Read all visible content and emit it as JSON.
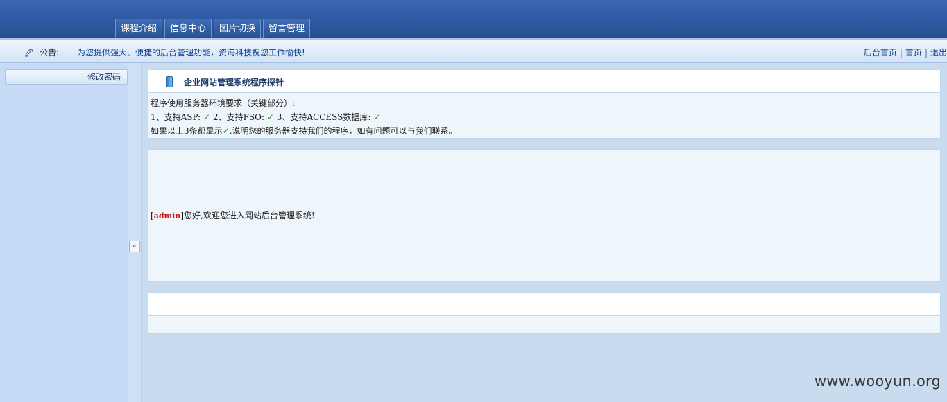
{
  "header": {
    "nav_tabs": [
      {
        "label": "课程介绍"
      },
      {
        "label": "信息中心"
      },
      {
        "label": "图片切换"
      },
      {
        "label": "留言管理"
      }
    ]
  },
  "notice": {
    "label": "公告:",
    "text": "为您提供强大、便捷的后台管理功能，资海科技祝您工作愉快!",
    "links": [
      {
        "label": "后台首页"
      },
      {
        "label": "首页"
      },
      {
        "label": "退出"
      }
    ],
    "separator": "|"
  },
  "sidebar": {
    "items": [
      {
        "label": "修改密码"
      }
    ],
    "collapse_label": "«"
  },
  "probe_panel": {
    "title": "企业网站管理系统程序探针",
    "line1": "程序使用服务器环境要求（关键部分）:",
    "req1": "1、支持ASP:",
    "req2": "2、支持FSO:",
    "req3": "3、支持ACCESS数据库:",
    "check_mark": "✓",
    "line3_pre": "如果以上3条都显示",
    "line3_post": ",说明您的服务器支持我们的程序，如有问题可以与我们联系。"
  },
  "welcome_panel": {
    "bracket_open": "[",
    "username": "admin",
    "bracket_close": "]",
    "message": "您好,欢迎您进入网站后台管理系统!"
  },
  "watermark": "www.wooyun.org"
}
